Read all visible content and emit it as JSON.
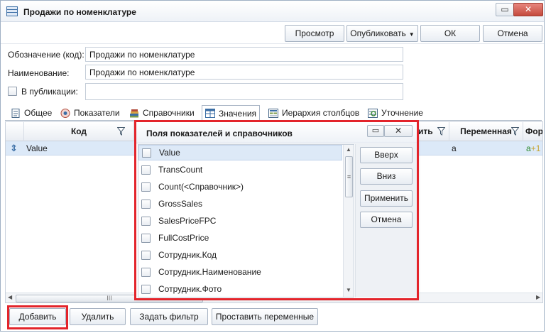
{
  "window": {
    "title": "Продажи по номенклатуре",
    "restore_icon": "▭",
    "close_icon": "✕"
  },
  "toolbar": {
    "preview_label": "Просмотр",
    "publish_label": "Опубликовать",
    "publish_caret": "▼",
    "ok_label": "ОК",
    "cancel_label": "Отмена"
  },
  "form": {
    "code_label": "Обозначение (код):",
    "code_value": "Продажи по номенклатуре",
    "name_label": "Наименование:",
    "name_value": "Продажи по номенклатуре",
    "publication_label": "В публикации:",
    "publication_value": ""
  },
  "tabs": [
    {
      "label": "Общее",
      "icon": "document-icon"
    },
    {
      "label": "Показатели",
      "icon": "indicators-icon"
    },
    {
      "label": "Справочники",
      "icon": "books-icon"
    },
    {
      "label": "Значения",
      "icon": "table-icon"
    },
    {
      "label": "Иерархия столбцов",
      "icon": "hierarchy-icon"
    },
    {
      "label": "Уточнение",
      "icon": "refine-icon"
    }
  ],
  "grid": {
    "columns": [
      "Код",
      "ить",
      "Переменная",
      "Форм"
    ],
    "row": {
      "code": "Value",
      "variable": "a",
      "formula_prefix": "a",
      "formula_op": "+1"
    },
    "row_marker": "⇕",
    "scroll_grip": "III",
    "scroll_left": "◀",
    "scroll_right": "▶"
  },
  "popup": {
    "title": "Поля показателей и справочников",
    "restore_icon": "▭",
    "close_icon": "✕",
    "fields": [
      "Value",
      "TransCount",
      "Count(<Справочник>)",
      "GrossSales",
      "SalesPriceFPC",
      "FullCostPrice",
      "Сотрудник.Код",
      "Сотрудник.Наименование",
      "Сотрудник.Фото"
    ],
    "up_label": "Вверх",
    "down_label": "Вниз",
    "apply_label": "Применить",
    "cancel_label": "Отмена",
    "scroll_grip": "≡",
    "scroll_up": "▲",
    "scroll_down": "▼"
  },
  "bottom": {
    "add_label": "Добавить",
    "delete_label": "Удалить",
    "filter_label": "Задать фильтр",
    "vars_label": "Проставить переменные"
  },
  "colors": {
    "highlight": "#e3242b",
    "selection": "#dce9f8",
    "accent": "#3b6ea5"
  }
}
